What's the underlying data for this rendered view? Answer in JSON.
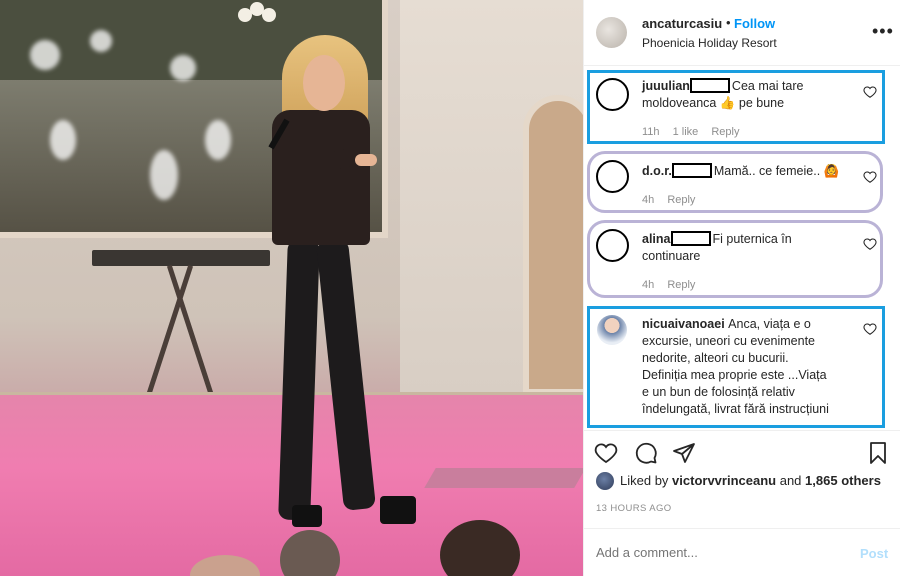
{
  "post": {
    "username": "ancaturcasiu",
    "separator": "•",
    "follow_label": "Follow",
    "location": "Phoenicia Holiday Resort",
    "more_label": "•••"
  },
  "comments": [
    {
      "user": "juuulian",
      "text": "Cea mai tare moldoveanca 👍 pe bune",
      "time": "11h",
      "likes": "1 like",
      "reply": "Reply"
    },
    {
      "user": "d.o.r.",
      "text": "Mamă.. ce femeie.. 🙆",
      "time": "4h",
      "reply": "Reply"
    },
    {
      "user": "alina",
      "text": "Fi puternica în continuare",
      "time": "4h",
      "reply": "Reply"
    },
    {
      "user": "nicuaivanoaei",
      "text": "Anca, viața e o excursie, uneori cu evenimente nedorite, alteori cu bucurii. Definiția mea proprie este ...Viața e un bun de folosință relativ îndelungată, livrat fără instrucțiuni"
    }
  ],
  "likes_line": {
    "prefix": "Liked by",
    "user": "victorvvrinceanu",
    "mid": "and",
    "count": "1,865 others"
  },
  "timestamp": "13 HOURS AGO",
  "add_comment": {
    "placeholder": "Add a comment...",
    "post_label": "Post"
  },
  "colors": {
    "highlight_blue": "#1a9ee0",
    "highlight_lavender": "#bab3d6",
    "link_blue": "#0095f6"
  }
}
